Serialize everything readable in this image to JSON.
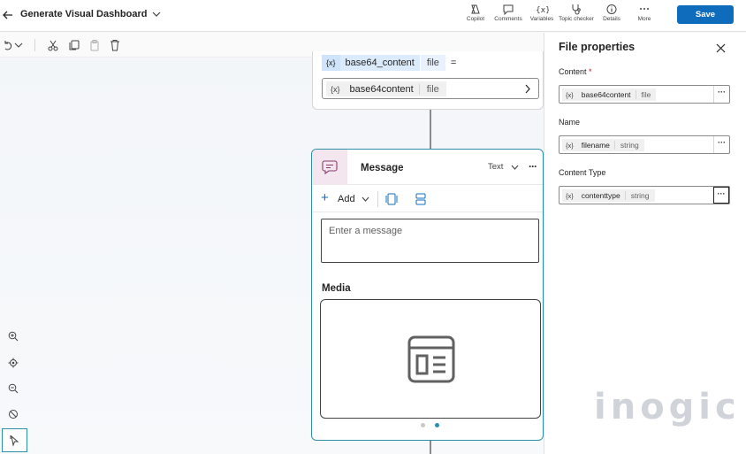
{
  "header": {
    "title": "Generate Visual Dashboard",
    "tools": [
      {
        "label": "Copilot",
        "icon": "copilot-icon"
      },
      {
        "label": "Comments",
        "icon": "comment-icon"
      },
      {
        "label": "Variables",
        "icon": "variables-icon"
      },
      {
        "label": "Topic checker",
        "icon": "stethoscope-icon"
      },
      {
        "label": "Details",
        "icon": "info-icon"
      },
      {
        "label": "More",
        "icon": "more-icon"
      }
    ],
    "save_label": "Save",
    "accent_color": "#0f6cbd"
  },
  "upper_node": {
    "var_symbol": "{x}",
    "var_name": "base64_content",
    "var_type": "file",
    "operator": "=",
    "value_symbol": "{x}",
    "value_name": "base64content",
    "value_type": "file"
  },
  "message_node": {
    "title": "Message",
    "type_label": "Text",
    "more": "···",
    "add_label": "Add",
    "input_placeholder": "Enter a message",
    "media_label": "Media",
    "border_color": "#2e8fa8"
  },
  "panel": {
    "title": "File properties",
    "fields": [
      {
        "label": "Content",
        "required": "*",
        "symbol": "{x}",
        "name": "base64content",
        "type": "file",
        "more": "···"
      },
      {
        "label": "Name",
        "symbol": "{x}",
        "name": "filename",
        "type": "string",
        "more": "···"
      },
      {
        "label": "Content Type",
        "symbol": "{x}",
        "name": "contenttype",
        "type": "string",
        "more": "···"
      }
    ]
  },
  "watermark": "inogic"
}
